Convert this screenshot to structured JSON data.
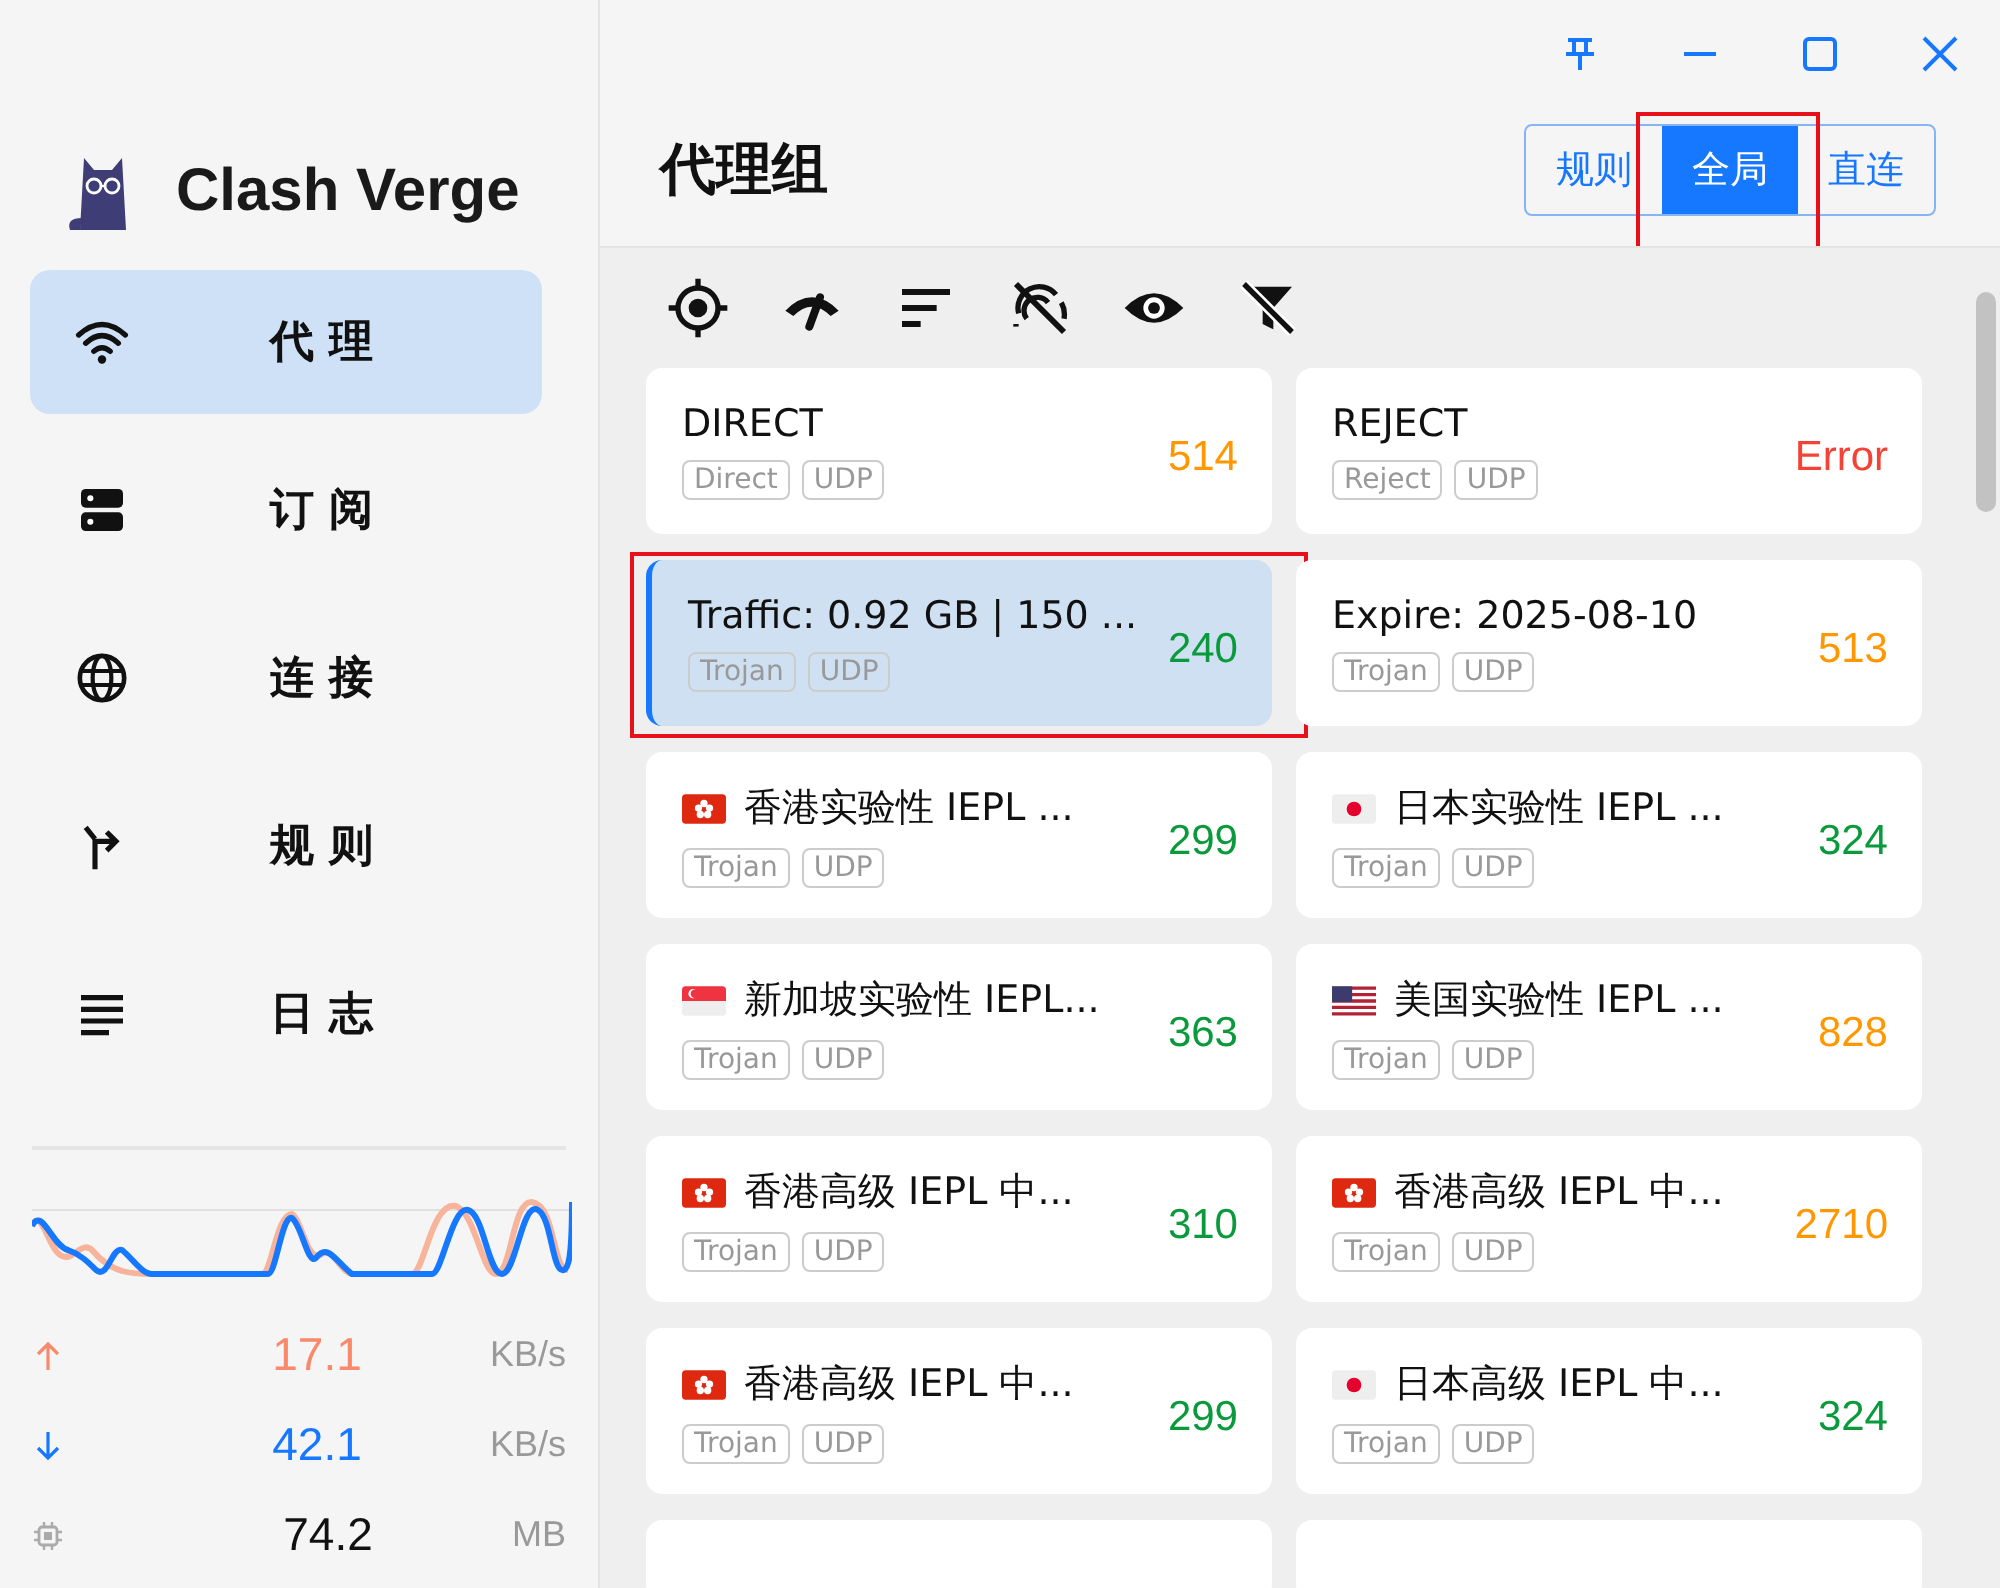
{
  "app": {
    "name": "Clash Verge"
  },
  "nav": [
    {
      "label": "代 理",
      "kind": "wifi",
      "selected": true
    },
    {
      "label": "订 阅",
      "kind": "server",
      "selected": false
    },
    {
      "label": "连 接",
      "kind": "globe",
      "selected": false
    },
    {
      "label": "规 则",
      "kind": "route",
      "selected": false
    },
    {
      "label": "日 志",
      "kind": "lines",
      "selected": false
    }
  ],
  "traffic": {
    "upload": {
      "value": "17.1",
      "unit": "KB/s"
    },
    "download": {
      "value": "42.1",
      "unit": "KB/s"
    },
    "memory": {
      "value": "74.2",
      "unit": "MB"
    }
  },
  "page": {
    "title": "代理组"
  },
  "modes": [
    {
      "label": "规则",
      "selected": false,
      "highlighted": false
    },
    {
      "label": "全局",
      "selected": true,
      "highlighted": true
    },
    {
      "label": "直连",
      "selected": false,
      "highlighted": false
    }
  ],
  "toolbar": [
    {
      "kind": "locate"
    },
    {
      "kind": "speed"
    },
    {
      "kind": "sort"
    },
    {
      "kind": "signaloff"
    },
    {
      "kind": "eye"
    },
    {
      "kind": "filteroff"
    }
  ],
  "proxies": [
    {
      "name": "DIRECT",
      "kind": "plain",
      "tags": [
        "Direct",
        "UDP"
      ],
      "delay": "514",
      "color": "#ff9800",
      "selected": false,
      "highlighted": false
    },
    {
      "name": "REJECT",
      "kind": "plain",
      "tags": [
        "Reject",
        "UDP"
      ],
      "delay": "Error",
      "color": "#f44336",
      "selected": false,
      "highlighted": false
    },
    {
      "name": "Traffic: 0.92 GB | 150 ...",
      "kind": "plain",
      "tags": [
        "Trojan",
        "UDP"
      ],
      "delay": "240",
      "color": "#0a9a3c",
      "selected": true,
      "highlighted": true
    },
    {
      "name": "Expire: 2025-08-10",
      "kind": "plain",
      "tags": [
        "Trojan",
        "UDP"
      ],
      "delay": "513",
      "color": "#ff9800",
      "selected": false,
      "highlighted": false
    },
    {
      "name": "香港实验性 IEPL ...",
      "kind": "hk",
      "tags": [
        "Trojan",
        "UDP"
      ],
      "delay": "299",
      "color": "#0a9a3c",
      "selected": false,
      "highlighted": false
    },
    {
      "name": "日本实验性 IEPL ...",
      "kind": "jp",
      "tags": [
        "Trojan",
        "UDP"
      ],
      "delay": "324",
      "color": "#0a9a3c",
      "selected": false,
      "highlighted": false
    },
    {
      "name": "新加坡实验性 IEPL...",
      "kind": "sg",
      "tags": [
        "Trojan",
        "UDP"
      ],
      "delay": "363",
      "color": "#0a9a3c",
      "selected": false,
      "highlighted": false
    },
    {
      "name": "美国实验性 IEPL ...",
      "kind": "us",
      "tags": [
        "Trojan",
        "UDP"
      ],
      "delay": "828",
      "color": "#ff9800",
      "selected": false,
      "highlighted": false
    },
    {
      "name": "香港高级 IEPL 中...",
      "kind": "hk",
      "tags": [
        "Trojan",
        "UDP"
      ],
      "delay": "310",
      "color": "#0a9a3c",
      "selected": false,
      "highlighted": false
    },
    {
      "name": "香港高级 IEPL 中...",
      "kind": "hk",
      "tags": [
        "Trojan",
        "UDP"
      ],
      "delay": "2710",
      "color": "#ff9800",
      "selected": false,
      "highlighted": false
    },
    {
      "name": "香港高级 IEPL 中...",
      "kind": "hk",
      "tags": [
        "Trojan",
        "UDP"
      ],
      "delay": "299",
      "color": "#0a9a3c",
      "selected": false,
      "highlighted": false
    },
    {
      "name": "日本高级 IEPL 中...",
      "kind": "jp",
      "tags": [
        "Trojan",
        "UDP"
      ],
      "delay": "324",
      "color": "#0a9a3c",
      "selected": false,
      "highlighted": false
    }
  ]
}
